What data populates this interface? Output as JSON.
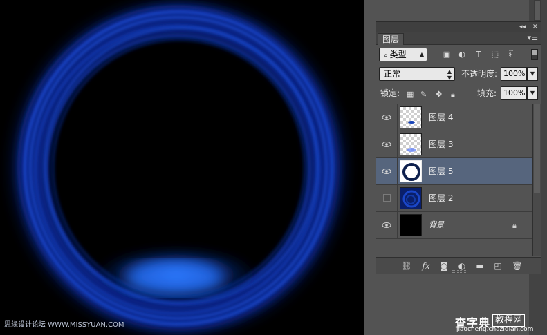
{
  "canvas": {
    "watermark_left": "思缘设计论坛 WWW.MISSYUAN.COM"
  },
  "panel": {
    "header_controls": {
      "collapse": "◂◂",
      "close": "✕"
    },
    "tab_label": "图层",
    "menu_icon": "panel-menu-icon",
    "filter": {
      "value": "类型",
      "search_icon": "search-icon"
    },
    "blend_mode": "正常",
    "opacity_label": "不透明度:",
    "opacity_value": "100%",
    "lock_label": "锁定:",
    "fill_label": "填充:",
    "fill_value": "100%",
    "layers": [
      {
        "name": "图层 4",
        "visible": true,
        "selected": false,
        "thumb": "small-blue-ellipse"
      },
      {
        "name": "图层 3",
        "visible": true,
        "selected": false,
        "thumb": "blue-glow"
      },
      {
        "name": "图层 5",
        "visible": true,
        "selected": true,
        "thumb": "dark-ring"
      },
      {
        "name": "图层 2",
        "visible": false,
        "selected": false,
        "thumb": "blue-texture"
      },
      {
        "name": "背景",
        "visible": true,
        "selected": false,
        "thumb": "black",
        "locked": true
      }
    ],
    "bottom_icons": [
      "link-icon",
      "fx-icon",
      "mask-icon",
      "adjustment-icon",
      "folder-icon",
      "new-layer-icon",
      "trash-icon"
    ]
  },
  "watermark_right": {
    "main": "查字典",
    "boxed": "教程网",
    "url": "jiaocheng.chazidian.com"
  },
  "colors": {
    "ring_primary": "#1a4fd8",
    "ring_dark": "#0a1e6e",
    "glow": "#2a72ff",
    "selected_layer": "#56657d",
    "panel_bg": "#535353"
  }
}
